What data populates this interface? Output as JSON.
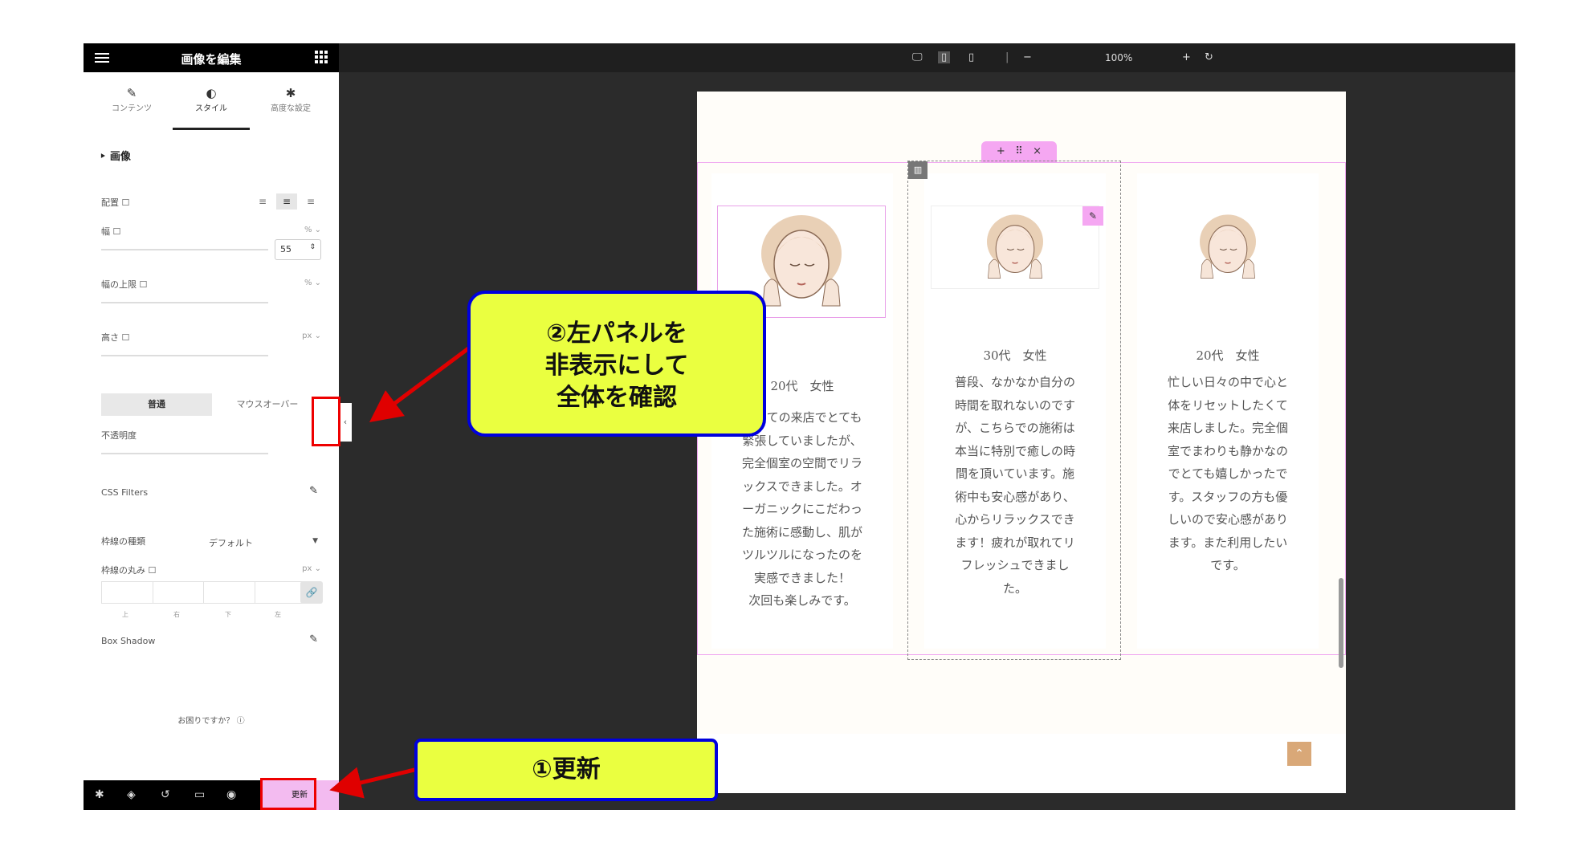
{
  "panel": {
    "title": "画像を編集",
    "tabs": [
      {
        "label": "コンテンツ",
        "icon": "pencil-icon"
      },
      {
        "label": "スタイル",
        "icon": "contrast-icon"
      },
      {
        "label": "高度な設定",
        "icon": "gear-icon"
      }
    ],
    "section_title": "画像",
    "fields": {
      "alignment": "配置",
      "width": "幅",
      "width_unit": "% ⌄",
      "width_value": "55",
      "max_width": "幅の上限",
      "max_width_unit": "% ⌄",
      "height": "高さ",
      "height_unit": "px ⌄",
      "opacity": "不透明度",
      "css_filters": "CSS Filters",
      "border_type": "枠線の種類",
      "border_type_value": "デフォルト",
      "border_radius": "枠線の丸み",
      "border_radius_unit": "px ⌄",
      "box_shadow": "Box Shadow"
    },
    "state_tabs": [
      "普通",
      "マウスオーバー"
    ],
    "dims": [
      "上",
      "右",
      "下",
      "左"
    ],
    "help": "お困りですか？ ⓘ",
    "update_label": "更新"
  },
  "toolbar": {
    "zoom": "100%"
  },
  "testimonials": [
    {
      "name": "20代　女性",
      "text": "初めての来店でとても\n緊張していましたが、\n完全個室の空間でリラ\nックスできました。オ\nーガニックにこだわっ\nた施術に感動し、肌が\nツルツルになったのを\n実感できました！\n次回も楽しみです。"
    },
    {
      "name": "30代　女性",
      "text": "普段、なかなか自分の\n時間を取れないのです\nが、こちらでの施術は\n本当に特別で癒しの時\n間を頂いています。施\n術中も安心感があり、\n心からリラックスでき\nます！疲れが取れてリ\nフレッシュできまし\nた。"
    },
    {
      "name": "20代　女性",
      "text": "忙しい日々の中で心と\n体をリセットしたくて\n来店しました。完全個\n室でまわりも静かなの\nでとても嬉しかったで\nす。スタッフの方も優\nしいので安心感があり\nます。また利用したい\nです。"
    }
  ],
  "callouts": {
    "hide_panel": "②左パネルを\n非表示にして\n全体を確認",
    "update": "①更新"
  },
  "colors": {
    "accent_pink": "#f5a7f2",
    "callout_bg": "#eaff40",
    "callout_border": "#0000dd",
    "arrow_red": "#e00000"
  }
}
